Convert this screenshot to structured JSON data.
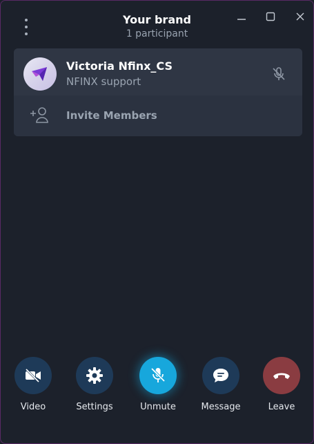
{
  "header": {
    "title": "Your brand",
    "subtitle": "1 participant",
    "menu_icon": "more-vertical-icon",
    "window_controls": [
      "minimize-icon",
      "maximize-icon",
      "close-icon"
    ]
  },
  "participants": [
    {
      "name": "Victoria Nfinx_CS",
      "status": "NFINX support",
      "mic_state": "muted",
      "mic_icon": "mic-off-icon"
    }
  ],
  "invite": {
    "label": "Invite Members",
    "icon": "add-user-icon"
  },
  "controls": [
    {
      "id": "video",
      "label": "Video",
      "icon": "video-off-icon",
      "color": "#1e3a58"
    },
    {
      "id": "settings",
      "label": "Settings",
      "icon": "gear-icon",
      "color": "#1e3a58"
    },
    {
      "id": "unmute",
      "label": "Unmute",
      "icon": "mic-off-icon",
      "color": "#17a7dc"
    },
    {
      "id": "message",
      "label": "Message",
      "icon": "chat-bubble-icon",
      "color": "#1e3a58"
    },
    {
      "id": "leave",
      "label": "Leave",
      "icon": "hang-up-icon",
      "color": "#8a3c41"
    }
  ],
  "colors": {
    "background": "#1c212b",
    "panel": "#2b3240",
    "accent": "#17a7dc",
    "danger": "#8a3c41",
    "window_border": "#5a2a66"
  }
}
